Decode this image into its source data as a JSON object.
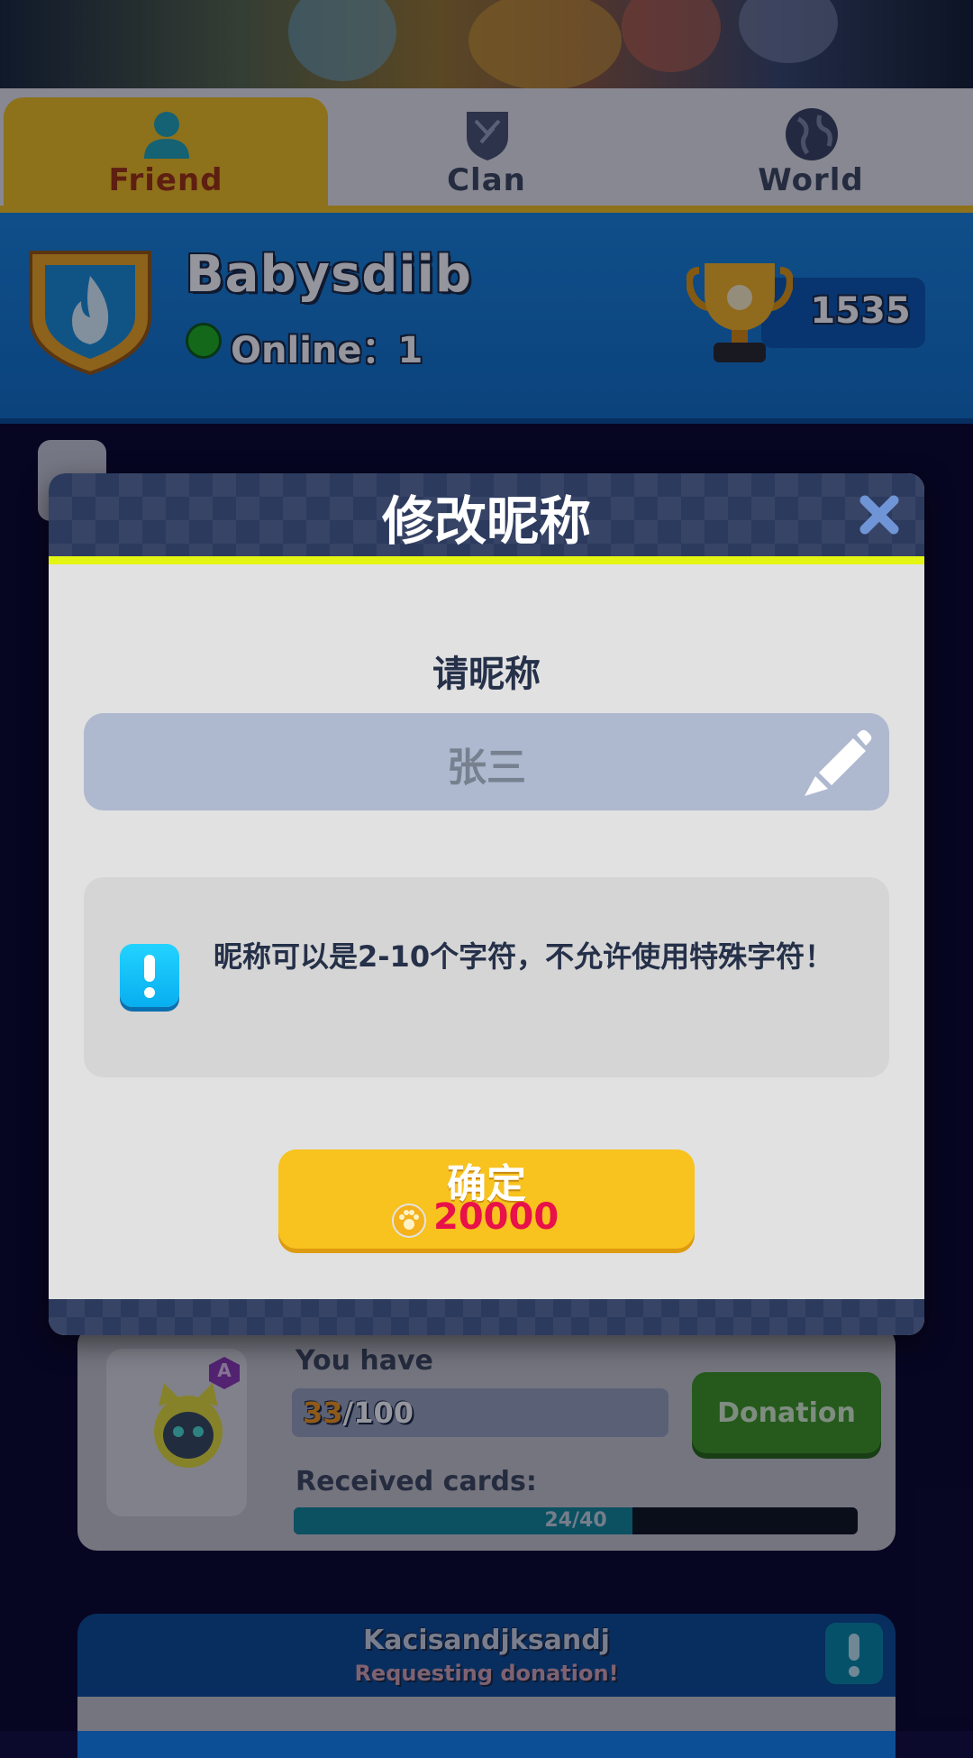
{
  "tabs": [
    {
      "label": "Friend",
      "icon": "friend-icon",
      "active": true
    },
    {
      "label": "Clan",
      "icon": "clan-shield-icon",
      "active": false
    },
    {
      "label": "World",
      "icon": "globe-icon",
      "active": false
    }
  ],
  "profile": {
    "name": "Babysdiib",
    "online_label": "Online：1",
    "trophies": "1535",
    "badge_icon": "flame-shield-icon",
    "trophy_icon": "trophy-icon"
  },
  "donation_card": {
    "you_have_label": "You have",
    "have_current": "33",
    "have_total": "/100",
    "donation_button": "Donation",
    "received_label": "Received cards:",
    "received_count": "24/40",
    "received_fraction": 0.6,
    "rarity_badge": "A"
  },
  "request_card": {
    "player": "Kacisandjksandj",
    "status": "Requesting donation!"
  },
  "modal": {
    "title": "修改昵称",
    "prompt": "请昵称",
    "name_value": "张三",
    "notice": "昵称可以是2-10个字符，不允许使用特殊字符！",
    "confirm_label": "确定",
    "confirm_cost": "20000"
  },
  "colors": {
    "accent_yellow": "#f8c21f",
    "header_navy": "#2c3a5e",
    "highlight_line": "#e4f514",
    "cost_red": "#e8114a",
    "info_cyan": "#08aef0"
  }
}
